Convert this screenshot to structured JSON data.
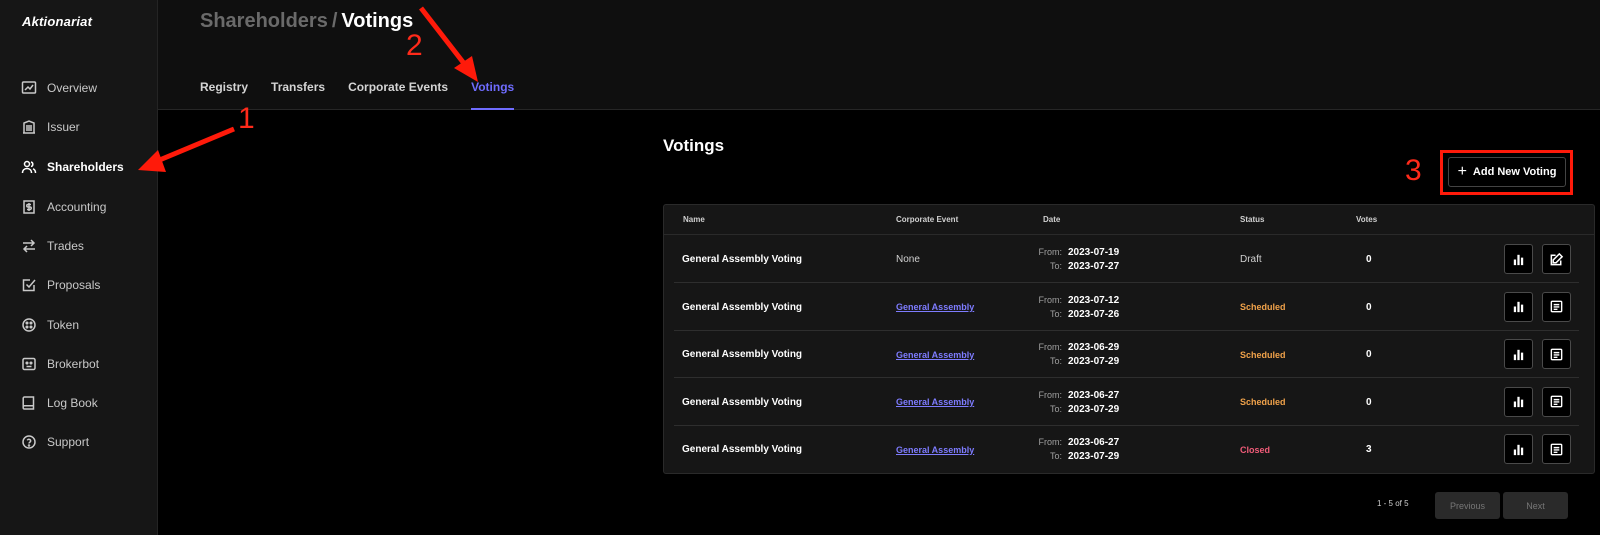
{
  "app": {
    "brand": "Aktionariat"
  },
  "sidebar": {
    "items": [
      {
        "label": "Overview",
        "icon": "chart-icon"
      },
      {
        "label": "Issuer",
        "icon": "building-icon"
      },
      {
        "label": "Shareholders",
        "icon": "users-icon",
        "active": true
      },
      {
        "label": "Accounting",
        "icon": "dollar-doc-icon"
      },
      {
        "label": "Trades",
        "icon": "arrows-swap-icon"
      },
      {
        "label": "Proposals",
        "icon": "check-square-icon"
      },
      {
        "label": "Token",
        "icon": "token-icon"
      },
      {
        "label": "Brokerbot",
        "icon": "robot-icon"
      },
      {
        "label": "Log Book",
        "icon": "book-icon"
      },
      {
        "label": "Support",
        "icon": "help-icon"
      }
    ]
  },
  "header": {
    "breadcrumb_parent": "Shareholders",
    "breadcrumb_separator": "/",
    "breadcrumb_current": "Votings",
    "tabs": [
      {
        "label": "Registry"
      },
      {
        "label": "Transfers"
      },
      {
        "label": "Corporate Events"
      },
      {
        "label": "Votings",
        "active": true
      }
    ]
  },
  "main": {
    "title": "Votings",
    "add_button_label": "Add New Voting",
    "table": {
      "headers": {
        "name": "Name",
        "corporate_event": "Corporate Event",
        "date": "Date",
        "status": "Status",
        "votes": "Votes"
      },
      "from_label": "From:",
      "to_label": "To:",
      "rows": [
        {
          "name": "General Assembly Voting",
          "event": "None",
          "event_link": false,
          "from": "2023-07-19",
          "to": "2023-07-27",
          "status": "Draft",
          "status_type": "draft",
          "votes": "0",
          "action2": "edit-icon"
        },
        {
          "name": "General Assembly Voting",
          "event": "General Assembly",
          "event_link": true,
          "from": "2023-07-12",
          "to": "2023-07-26",
          "status": "Scheduled",
          "status_type": "scheduled",
          "votes": "0",
          "action2": "document-icon"
        },
        {
          "name": "General Assembly Voting",
          "event": "General Assembly",
          "event_link": true,
          "from": "2023-06-29",
          "to": "2023-07-29",
          "status": "Scheduled",
          "status_type": "scheduled",
          "votes": "0",
          "action2": "document-icon"
        },
        {
          "name": "General Assembly Voting",
          "event": "General Assembly",
          "event_link": true,
          "from": "2023-06-27",
          "to": "2023-07-29",
          "status": "Scheduled",
          "status_type": "scheduled",
          "votes": "0",
          "action2": "document-icon"
        },
        {
          "name": "General Assembly Voting",
          "event": "General Assembly",
          "event_link": true,
          "from": "2023-06-27",
          "to": "2023-07-29",
          "status": "Closed",
          "status_type": "closed",
          "votes": "3",
          "action2": "document-icon"
        }
      ]
    },
    "pagination": {
      "info": "1 - 5 of 5",
      "previous": "Previous",
      "next": "Next"
    }
  },
  "annotations": {
    "step1": "1",
    "step2": "2",
    "step3": "3"
  },
  "colors": {
    "accent": "#6f6cff",
    "scheduled": "#f0a24a",
    "closed": "#f05b78",
    "annotation": "#ff2a1a"
  }
}
